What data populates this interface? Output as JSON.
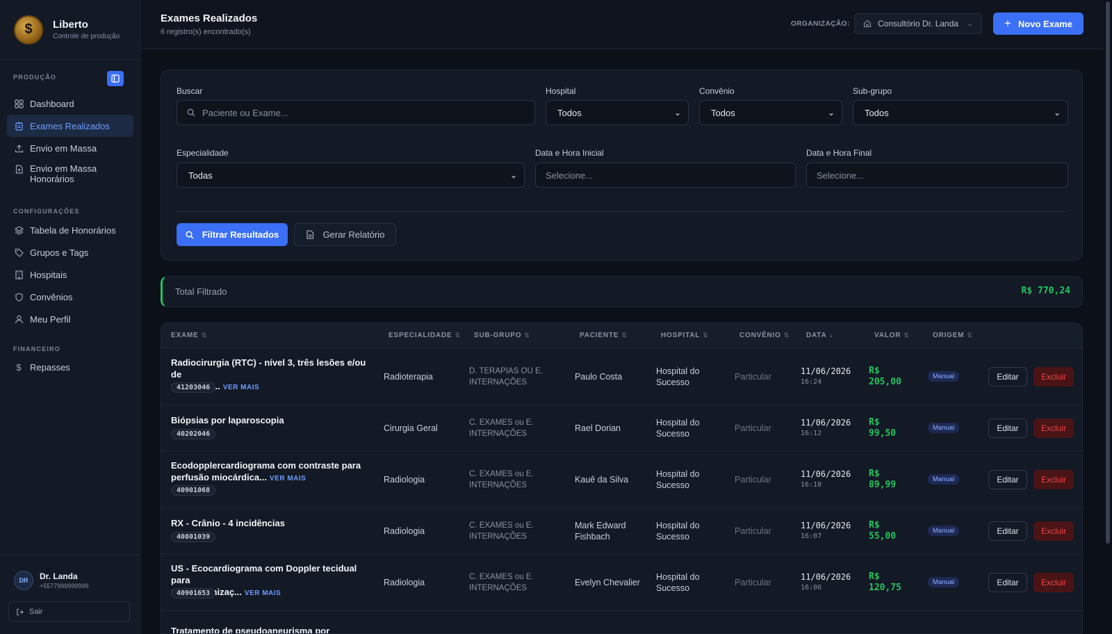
{
  "brand": {
    "name": "Liberto",
    "subtitle": "Controle de produção",
    "logo_glyph": "$"
  },
  "sidebar": {
    "sections": {
      "producao": "PRODUÇÃO",
      "configuracoes": "CONFIGURAÇÕES",
      "financeiro": "FINANCEIRO"
    },
    "items": [
      {
        "label": "Dashboard",
        "icon": "grid-icon"
      },
      {
        "label": "Exames Realizados",
        "icon": "clipboard-icon",
        "active": true
      },
      {
        "label": "Envio em Massa",
        "icon": "upload-icon"
      },
      {
        "label": "Envio em Massa Honorários",
        "icon": "file-upload-icon"
      },
      {
        "label": "Tabela de Honorários",
        "icon": "layers-icon"
      },
      {
        "label": "Grupos e Tags",
        "icon": "tag-icon"
      },
      {
        "label": "Hospitais",
        "icon": "building-icon"
      },
      {
        "label": "Convênios",
        "icon": "shield-icon"
      },
      {
        "label": "Meu Perfil",
        "icon": "user-icon"
      },
      {
        "label": "Repasses",
        "icon": "dollar-icon"
      }
    ],
    "user": {
      "initials": "DR",
      "name": "Dr. Landa",
      "phone": "+5577999999999",
      "logout": "Sair"
    }
  },
  "header": {
    "title": "Exames Realizados",
    "subtitle": "6 registro(s) encontrado(s)",
    "org_label": "ORGANIZAÇÃO:",
    "org_value": "Consultório Dr. Landa",
    "new_button": "Novo Exame"
  },
  "filters": {
    "search": {
      "label": "Buscar",
      "placeholder": "Paciente ou Exame..."
    },
    "hospital": {
      "label": "Hospital",
      "value": "Todos"
    },
    "convenio": {
      "label": "Convênio",
      "value": "Todos"
    },
    "subgrupo": {
      "label": "Sub-grupo",
      "value": "Todos"
    },
    "especialidade": {
      "label": "Especialidade",
      "value": "Todas"
    },
    "data_inicial": {
      "label": "Data e Hora Inicial",
      "placeholder": "Selecione..."
    },
    "data_final": {
      "label": "Data e Hora Final",
      "placeholder": "Selecione..."
    },
    "filter_button": "Filtrar Resultados",
    "report_button": "Gerar Relatório"
  },
  "total": {
    "label": "Total Filtrado",
    "value": "R$ 770,24"
  },
  "table": {
    "headers": [
      "EXAME",
      "ESPECIALIDADE",
      "SUB-GRUPO",
      "PACIENTE",
      "HOSPITAL",
      "CONVÊNIO",
      "DATA",
      "VALOR",
      "ORIGEM"
    ],
    "ver_mais": "VER MAIS",
    "edit_label": "Editar",
    "delete_label": "Excluir",
    "rows": [
      {
        "exam_line1": "Radiocirurgia (RTC) - nível 3, três lesões e/ou de",
        "exam_line2": "mais de q...",
        "more": true,
        "code": "41203046",
        "especialidade": "Radioterapia",
        "subgrupo_1": "D. TERAPIAS OU E.",
        "subgrupo_2": "INTERNAÇÕES",
        "paciente_1": "Paulo Costa",
        "paciente_2": "",
        "hospital_1": "Hospital do",
        "hospital_2": "Sucesso",
        "convenio": "Particular",
        "date": "11/06/2026",
        "time": "16:24",
        "valor_1": "R$",
        "valor_2": "205,00",
        "origem": "Manual"
      },
      {
        "exam_line1": "Biópsias por laparoscopia",
        "exam_line2": "",
        "more": false,
        "code": "40202046",
        "especialidade": "Cirurgia Geral",
        "subgrupo_1": "C. EXAMES ou E.",
        "subgrupo_2": "INTERNAÇÕES",
        "paciente_1": "Rael Dorian",
        "paciente_2": "",
        "hospital_1": "Hospital do",
        "hospital_2": "Sucesso",
        "convenio": "Particular",
        "date": "11/06/2026",
        "time": "16:12",
        "valor_1": "R$",
        "valor_2": "99,50",
        "origem": "Manual"
      },
      {
        "exam_line1": "Ecodopplercardiograma com contraste para",
        "exam_line2": "perfusão miocárdica...",
        "more": true,
        "code": "40901068",
        "especialidade": "Radiologia",
        "subgrupo_1": "C. EXAMES ou E.",
        "subgrupo_2": "INTERNAÇÕES",
        "paciente_1": "Kauê da Silva",
        "paciente_2": "",
        "hospital_1": "Hospital do",
        "hospital_2": "Sucesso",
        "convenio": "Particular",
        "date": "11/06/2026",
        "time": "16:10",
        "valor_1": "R$",
        "valor_2": "89,99",
        "origem": "Manual"
      },
      {
        "exam_line1": "RX - Crânio - 4 incidências",
        "exam_line2": "",
        "more": false,
        "code": "40801039",
        "especialidade": "Radiologia",
        "subgrupo_1": "C. EXAMES ou E.",
        "subgrupo_2": "INTERNAÇÕES",
        "paciente_1": "Mark Edward",
        "paciente_2": "Fishbach",
        "hospital_1": "Hospital do",
        "hospital_2": "Sucesso",
        "convenio": "Particular",
        "date": "11/06/2026",
        "time": "16:07",
        "valor_1": "R$",
        "valor_2": "55,00",
        "origem": "Manual"
      },
      {
        "exam_line1": "US - Ecocardiograma com Doppler tecidual para",
        "exam_line2": "ressincronizaç...",
        "more": true,
        "code": "40901653",
        "especialidade": "Radiologia",
        "subgrupo_1": "C. EXAMES ou E.",
        "subgrupo_2": "INTERNAÇÕES",
        "paciente_1": "Evelyn Chevalier",
        "paciente_2": "",
        "hospital_1": "Hospital do",
        "hospital_2": "Sucesso",
        "convenio": "Particular",
        "date": "11/06/2026",
        "time": "16:06",
        "valor_1": "R$",
        "valor_2": "120,75",
        "origem": "Manual"
      },
      {
        "exam_line1": "Tratamento de pseudoaneurisma por",
        "exam_line2": "",
        "more": false,
        "code": "",
        "especialidade": "",
        "subgrupo_1": "",
        "subgrupo_2": "",
        "paciente_1": "",
        "paciente_2": "",
        "hospital_1": "",
        "hospital_2": "",
        "convenio": "",
        "date": "",
        "time": "",
        "valor_1": "",
        "valor_2": "",
        "origem": ""
      }
    ]
  },
  "colors": {
    "accent": "#3b6ff5",
    "success": "#22c55e",
    "danger": "#ef4444",
    "background": "#0c1018",
    "panel": "#131925"
  }
}
